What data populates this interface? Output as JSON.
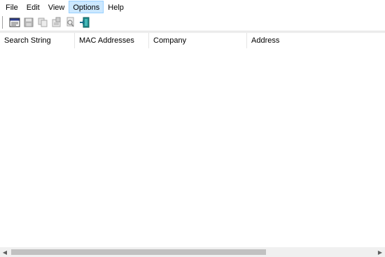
{
  "menu": {
    "items": [
      {
        "label": "File"
      },
      {
        "label": "Edit"
      },
      {
        "label": "View"
      },
      {
        "label": "Options"
      },
      {
        "label": "Help"
      }
    ]
  },
  "toolbar": {
    "buttons": [
      {
        "icon": "html-report-icon"
      },
      {
        "icon": "save-icon"
      },
      {
        "icon": "copy-icon"
      },
      {
        "icon": "properties-icon"
      },
      {
        "icon": "find-icon"
      },
      {
        "icon": "exit-icon"
      }
    ]
  },
  "table": {
    "columns": [
      {
        "label": "Search String"
      },
      {
        "label": "MAC Addresses"
      },
      {
        "label": "Company"
      },
      {
        "label": "Address"
      }
    ],
    "rows": []
  },
  "colors": {
    "menu_active_bg": "#cce8ff",
    "menu_active_border": "#99d1ff",
    "scroll_thumb": "#c1c1c1"
  }
}
